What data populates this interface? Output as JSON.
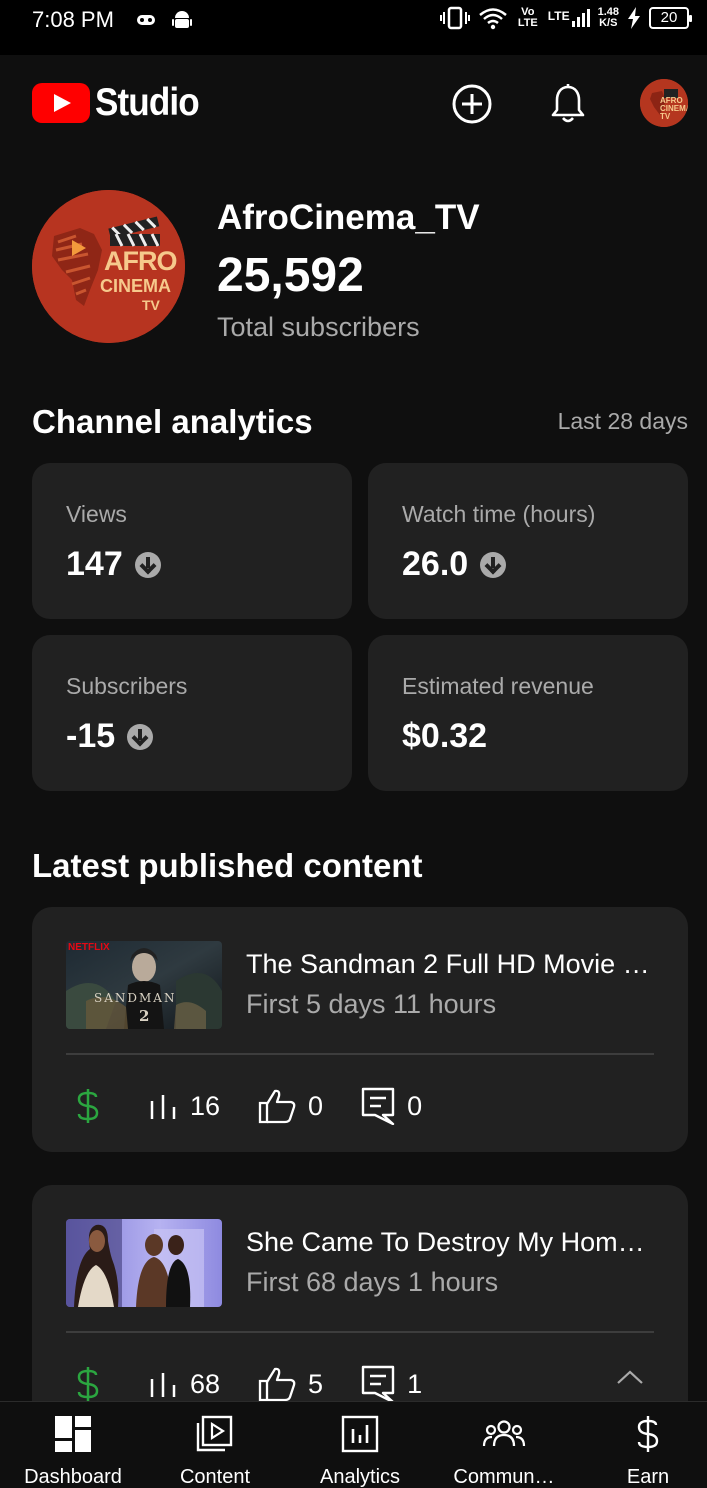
{
  "status_bar": {
    "time": "7:08 PM",
    "volte": "Vo LTE",
    "lte": "LTE",
    "speed_value": "1.48",
    "speed_unit": "K/S",
    "battery": "20"
  },
  "header": {
    "app_title": "Studio",
    "avatar_text": "AFRO CINEMA TV"
  },
  "channel": {
    "name": "AfroCinema_TV",
    "subscribers": "25,592",
    "subscribers_label": "Total subscribers",
    "logo_line1": "AFRO",
    "logo_line2": "CINEMA",
    "logo_line3": "TV"
  },
  "analytics": {
    "title": "Channel analytics",
    "range": "Last 28 days",
    "cards": [
      {
        "label": "Views",
        "value": "147",
        "trend": "down"
      },
      {
        "label": "Watch time (hours)",
        "value": "26.0",
        "trend": "down"
      },
      {
        "label": "Subscribers",
        "value": "-15",
        "trend": "down"
      },
      {
        "label": "Estimated revenue",
        "value": "$0.32",
        "trend": "none"
      }
    ]
  },
  "latest": {
    "title": "Latest published content",
    "items": [
      {
        "title": "The Sandman 2 Full HD Movie …",
        "subtitle": "First 5 days 11 hours",
        "thumb_badge": "NETFLIX",
        "thumb_title": "SANDMAN",
        "thumb_number": "2",
        "views": "16",
        "likes": "0",
        "comments": "0"
      },
      {
        "title": "She Came To Destroy My Hom…",
        "subtitle": "First 68 days 1 hours",
        "views": "68",
        "likes": "5",
        "comments": "1"
      }
    ]
  },
  "bottom_nav": [
    {
      "label": "Dashboard",
      "icon": "dashboard-icon"
    },
    {
      "label": "Content",
      "icon": "content-icon"
    },
    {
      "label": "Analytics",
      "icon": "analytics-icon"
    },
    {
      "label": "Commun…",
      "icon": "community-icon"
    },
    {
      "label": "Earn",
      "icon": "earn-icon"
    }
  ],
  "colors": {
    "background": "#0f0f0f",
    "card": "#212121",
    "brand_red": "#ff0000",
    "monetization_green": "#2ba640",
    "secondary_text": "#aaaaaa"
  }
}
